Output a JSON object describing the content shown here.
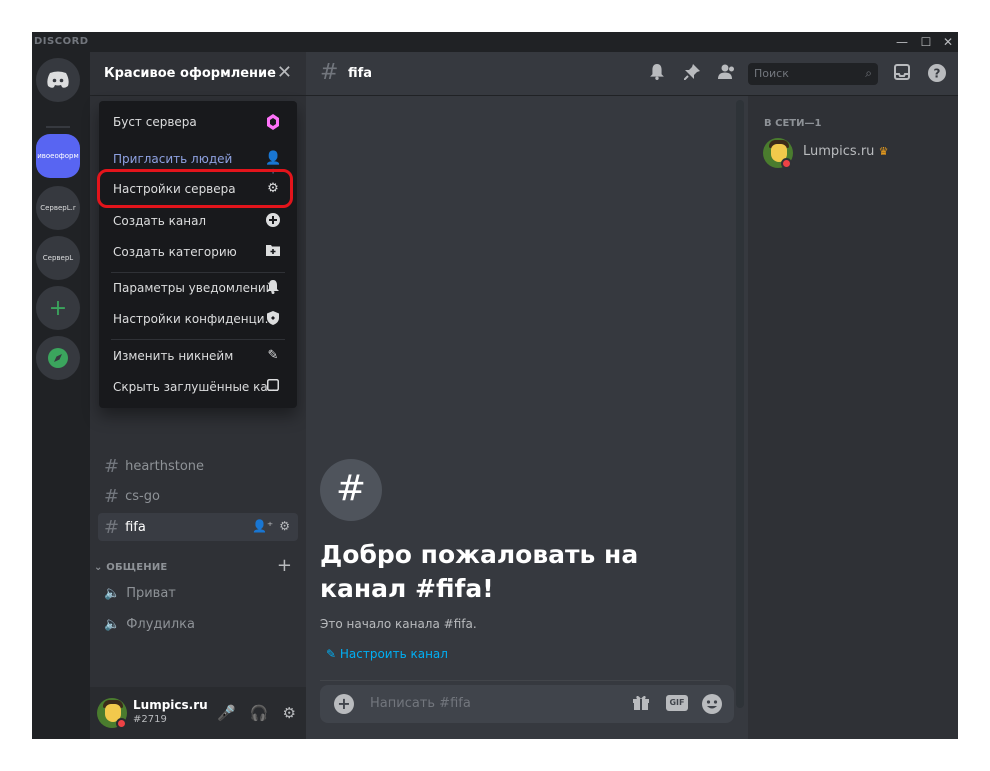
{
  "app": {
    "brand": "DISCORD"
  },
  "window_controls": {
    "minimize": "—",
    "maximize": "☐",
    "close": "✕"
  },
  "servers": [
    {
      "label": "",
      "icon": "discord-logo-icon"
    },
    {
      "label": "ивоеоформ",
      "active": true
    },
    {
      "label": "СерверL.r"
    },
    {
      "label": "СерверL"
    },
    {
      "label": "+",
      "icon": "add-server-icon"
    },
    {
      "label": "",
      "icon": "explore-compass-icon"
    }
  ],
  "guild": {
    "title": "Красивое оформление",
    "close": "✕"
  },
  "menu": {
    "items": [
      {
        "label": "Буст сервера",
        "icon": "boost-gem-icon"
      },
      {
        "label": "Пригласить людей",
        "icon": "invite-people-icon"
      },
      {
        "label": "Настройки сервера",
        "icon": "gear-icon"
      },
      {
        "label": "Создать канал",
        "icon": "plus-circle-icon"
      },
      {
        "label": "Создать категорию",
        "icon": "folder-plus-icon"
      },
      {
        "label": "Параметры уведомлений",
        "icon": "bell-icon"
      },
      {
        "label": "Настройки конфиденци...",
        "icon": "shield-icon"
      },
      {
        "label": "Изменить никнейм",
        "icon": "pencil-icon"
      },
      {
        "label": "Скрыть заглушённые ка...",
        "icon": "checkbox-icon"
      }
    ]
  },
  "categories": [
    {
      "name": "ОБЩЕНИЕ"
    }
  ],
  "channels": {
    "text": [
      "hearthstone",
      "cs-go",
      "fifa"
    ],
    "voice": [
      "Приват",
      "Флудилка"
    ]
  },
  "user": {
    "name": "Lumpics.ru",
    "tag": "#2719"
  },
  "chat": {
    "channel": "fifa",
    "search_placeholder": "Поиск",
    "welcome_title": "Добро пожаловать на канал #fifa!",
    "welcome_sub": "Это начало канала #fifa.",
    "setup_link": "Настроить канал",
    "composer_placeholder": "Написать #fifa",
    "gif_label": "GIF"
  },
  "member_list": {
    "category": "В СЕТИ—1",
    "members": [
      {
        "name": "Lumpics.ru",
        "badge": "crown-icon"
      }
    ]
  },
  "colors": {
    "accent": "#5865f2",
    "highlight": "#e3141b",
    "link": "#00aff4",
    "dnd": "#ed4245"
  }
}
